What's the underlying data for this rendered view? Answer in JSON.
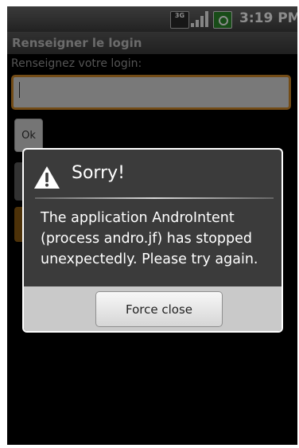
{
  "status_bar": {
    "network_label": "3G",
    "time": "3:19 PM"
  },
  "app": {
    "title": "Renseigner le login",
    "prompt": "Renseignez votre login:",
    "login_value": "",
    "ok_label": "Ok"
  },
  "dialog": {
    "icon": "warning-icon",
    "title": "Sorry!",
    "message": "The application AndroIntent (process andro.jf) has stopped unexpectedly. Please try again.",
    "button_label": "Force close"
  }
}
